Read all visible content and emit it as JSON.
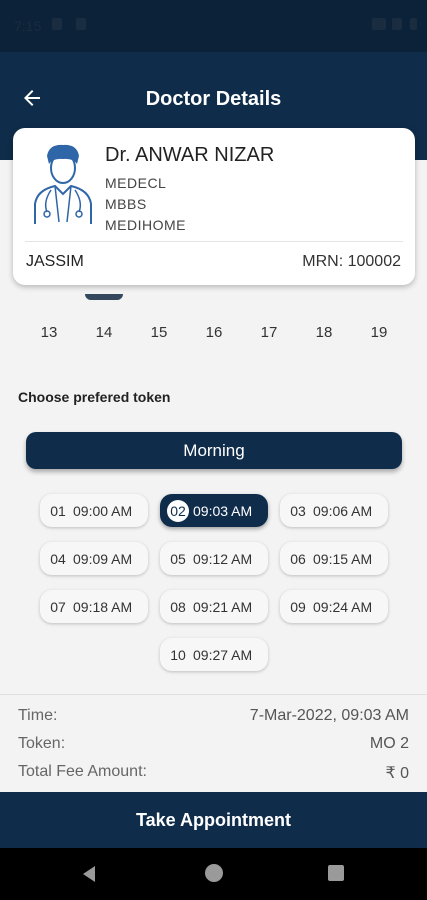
{
  "status_bar": {
    "time": "7:15"
  },
  "header": {
    "title": "Doctor Details"
  },
  "doctor": {
    "name": "Dr. ANWAR NIZAR",
    "lines": [
      "MEDECL",
      "MBBS",
      "MEDIHOME"
    ],
    "patient": "JASSIM",
    "mrn": "MRN: 100002"
  },
  "dates": [
    "13",
    "14",
    "15",
    "16",
    "17",
    "18",
    "19"
  ],
  "choose_label": "Choose prefered token",
  "session": "Morning",
  "tokens": [
    {
      "num": "01",
      "time": "09:00 AM"
    },
    {
      "num": "02",
      "time": "09:03 AM"
    },
    {
      "num": "03",
      "time": "09:06 AM"
    },
    {
      "num": "04",
      "time": "09:09 AM"
    },
    {
      "num": "05",
      "time": "09:12 AM"
    },
    {
      "num": "06",
      "time": "09:15 AM"
    },
    {
      "num": "07",
      "time": "09:18 AM"
    },
    {
      "num": "08",
      "time": "09:21 AM"
    },
    {
      "num": "09",
      "time": "09:24 AM"
    },
    {
      "num": "10",
      "time": "09:27 AM"
    }
  ],
  "selected_token": "02",
  "summary": {
    "time_label": "Time:",
    "time_value": "7-Mar-2022, 09:03 AM",
    "token_label": "Token:",
    "token_value": "MO 2",
    "fee_label": "Total Fee Amount:",
    "fee_value": "₹ 0"
  },
  "action_button": "Take Appointment",
  "colors": {
    "primary": "#0f2c4a",
    "background": "#f3f3f3",
    "card": "#ffffff"
  },
  "icons": [
    "back-arrow-icon",
    "doctor-avatar-icon",
    "nav-back-icon",
    "nav-home-icon",
    "nav-recents-icon"
  ]
}
